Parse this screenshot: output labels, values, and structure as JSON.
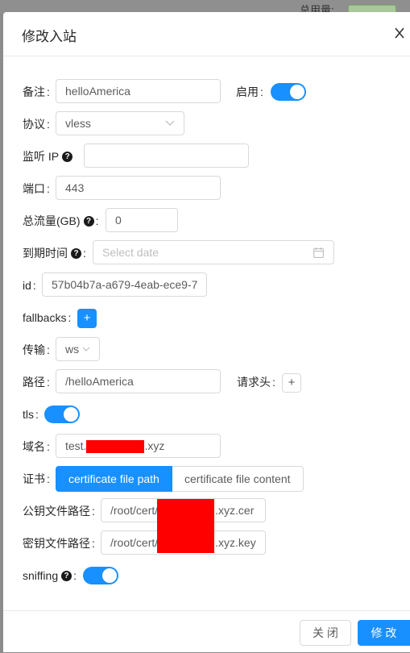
{
  "background": {
    "text": "总用量:"
  },
  "modal": {
    "title": "修改入站",
    "fields": {
      "remark": {
        "label": "备注",
        "value": "helloAmerica"
      },
      "enable": {
        "label": "启用",
        "on": true
      },
      "protocol": {
        "label": "协议",
        "value": "vless"
      },
      "listen_ip": {
        "label": "监听 IP",
        "value": ""
      },
      "port": {
        "label": "端口",
        "value": "443"
      },
      "total_traffic": {
        "label": "总流量(GB)",
        "value": "0"
      },
      "expiry": {
        "label": "到期时间",
        "placeholder": "Select date"
      },
      "id": {
        "label": "id",
        "value": "57b04b7a-a679-4eab-ece9-7"
      },
      "fallbacks": {
        "label": "fallbacks",
        "button": "+"
      },
      "transport": {
        "label": "传输",
        "value": "ws"
      },
      "path": {
        "label": "路径",
        "value": "/helloAmerica"
      },
      "request_header": {
        "label": "请求头",
        "button": "+"
      },
      "tls": {
        "label": "tls",
        "on": true
      },
      "domain": {
        "label": "域名",
        "value_prefix": "test.",
        "value_suffix": ".xyz"
      },
      "certificate": {
        "label": "证书",
        "options": [
          "certificate file path",
          "certificate file content"
        ],
        "selected": "certificate file path"
      },
      "public_key_path": {
        "label": "公钥文件路径",
        "value_prefix": "/root/cert/",
        "value_suffix": ".xyz.cer"
      },
      "private_key_path": {
        "label": "密钥文件路径",
        "value_prefix": "/root/cert/",
        "value_suffix": ".xyz.key"
      },
      "sniffing": {
        "label": "sniffing",
        "on": true
      }
    },
    "footer": {
      "close": "关 闭",
      "submit": "修 改"
    }
  },
  "colors": {
    "primary": "#1890ff",
    "redaction": "#ff0000"
  }
}
